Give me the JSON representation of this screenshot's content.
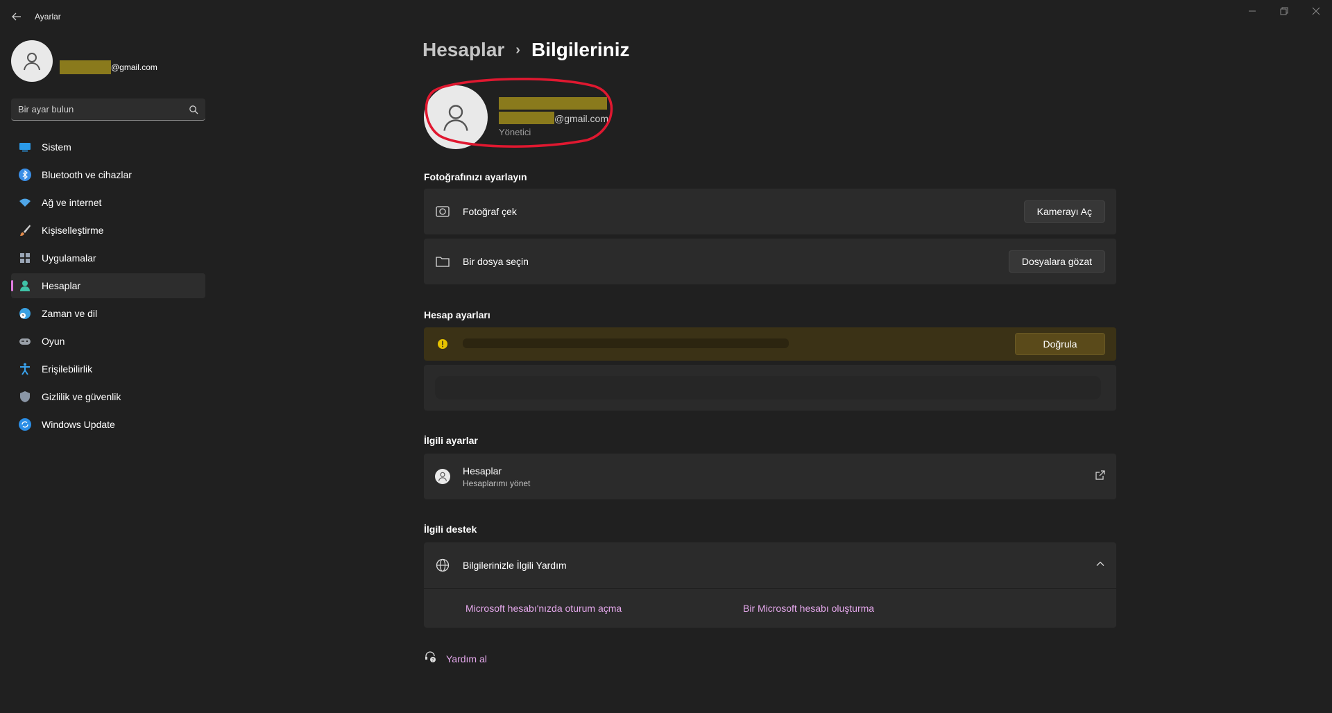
{
  "window": {
    "title": "Ayarlar"
  },
  "profile": {
    "email_suffix": "@gmail.com"
  },
  "search": {
    "placeholder": "Bir ayar bulun"
  },
  "sidebar": {
    "items": [
      {
        "label": "Sistem",
        "icon": "monitor-icon",
        "color": "#2b9ae9"
      },
      {
        "label": "Bluetooth ve cihazlar",
        "icon": "bluetooth-icon",
        "color": "#3a8ee6"
      },
      {
        "label": "Ağ ve internet",
        "icon": "wifi-icon",
        "color": "#4fa6e8"
      },
      {
        "label": "Kişiselleştirme",
        "icon": "brush-icon",
        "color": "#e08a4a"
      },
      {
        "label": "Uygulamalar",
        "icon": "apps-icon",
        "color": "#9aa6b6"
      },
      {
        "label": "Hesaplar",
        "icon": "account-icon",
        "color": "#3fc2a6",
        "active": true
      },
      {
        "label": "Zaman ve dil",
        "icon": "globe-clock-icon",
        "color": "#3aa0e0"
      },
      {
        "label": "Oyun",
        "icon": "gamepad-icon",
        "color": "#9aa0a8"
      },
      {
        "label": "Erişilebilirlik",
        "icon": "accessibility-icon",
        "color": "#3aa4f0"
      },
      {
        "label": "Gizlilik ve güvenlik",
        "icon": "shield-icon",
        "color": "#8a96a6"
      },
      {
        "label": "Windows Update",
        "icon": "update-icon",
        "color": "#2b8ee6"
      }
    ]
  },
  "breadcrumb": {
    "parent": "Hesaplar",
    "separator": "›",
    "current": "Bilgileriniz"
  },
  "user": {
    "email_suffix": "@gmail.com",
    "role": "Yönetici"
  },
  "photo_section": {
    "title": "Fotoğrafınızı ayarlayın",
    "take_photo": {
      "label": "Fotoğraf çek",
      "button": "Kamerayı Aç"
    },
    "choose_file": {
      "label": "Bir dosya seçin",
      "button": "Dosyalara gözat"
    }
  },
  "account_settings": {
    "title": "Hesap ayarları",
    "verify_button": "Doğrula"
  },
  "related_settings": {
    "title": "İlgili ayarlar",
    "accounts": {
      "label": "Hesaplar",
      "sub": "Hesaplarımı yönet"
    }
  },
  "related_support": {
    "title": "İlgili destek",
    "help_header": "Bilgilerinizle İlgili Yardım",
    "links": [
      "Microsoft hesabı'nızda oturum açma",
      "Bir Microsoft hesabı oluşturma"
    ]
  },
  "get_help": {
    "label": "Yardım al"
  },
  "colors": {
    "accent": "#e07be0",
    "link": "#e5a8ec",
    "annotation": "#e01830"
  }
}
